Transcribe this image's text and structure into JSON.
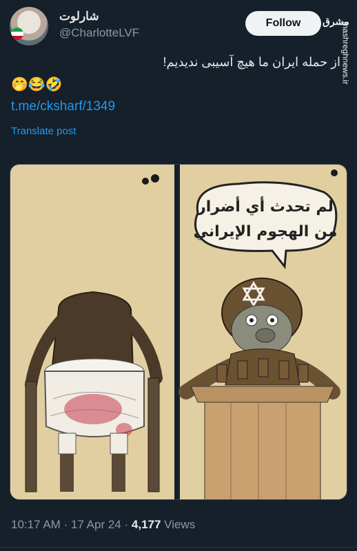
{
  "author": {
    "display_name": "شارلوت",
    "handle": "@CharlotteLVF"
  },
  "actions": {
    "follow_label": "Follow"
  },
  "watermark": {
    "logo": "مشرق",
    "site": "mashreghnews.ir"
  },
  "tweet": {
    "text": "از حمله ایران ما هیچ آسیبی ندیدیم!",
    "emojis": "🤭😂🤣",
    "link": "t.me/cksharf/1349",
    "translate_label": "Translate post"
  },
  "cartoon": {
    "speech_line1": "لم تحدث أي أضرار",
    "speech_line2": "من الهجوم الإيراني"
  },
  "meta": {
    "time": "10:17 AM",
    "sep1": "·",
    "date": "17 Apr 24",
    "sep2": "·",
    "views_count": "4,177",
    "views_label": "Views"
  },
  "colors": {
    "background": "#15202b",
    "accent": "#1d9bf0",
    "panel": "#e2cfa1"
  }
}
